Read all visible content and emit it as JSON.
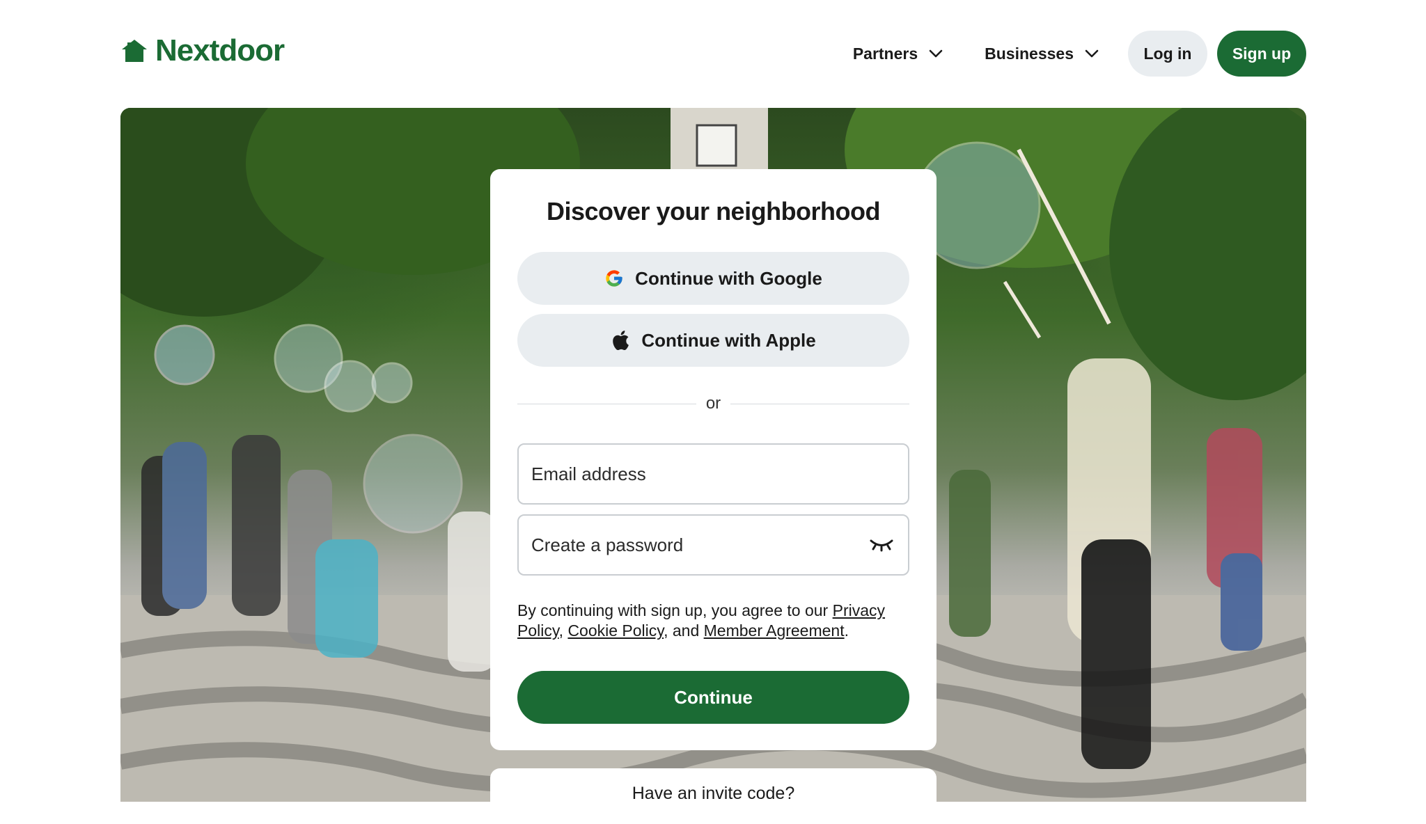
{
  "brand": {
    "name": "Nextdoor",
    "color": "#1b6b34",
    "logo_icon": "house-icon"
  },
  "nav": {
    "partners_label": "Partners",
    "businesses_label": "Businesses",
    "login_label": "Log in",
    "signup_label": "Sign up",
    "dropdown_icon": "chevron-down-icon"
  },
  "hero": {
    "image_description_icon": "photo-background"
  },
  "signup_card": {
    "title": "Discover your neighborhood",
    "google_label": "Continue with Google",
    "apple_label": "Continue with Apple",
    "divider_text": "or",
    "email_placeholder": "Email address",
    "password_placeholder": "Create a password",
    "password_toggle_icon": "eye-closed-icon",
    "terms": {
      "prefix": "By continuing with sign up, you agree to our ",
      "privacy_link": "Privacy Policy",
      "sep1": ", ",
      "cookie_link": "Cookie Policy",
      "sep2": ", and ",
      "member_link": "Member Agreement",
      "suffix": "."
    },
    "continue_label": "Continue"
  },
  "invite": {
    "label": "Have an invite code?"
  },
  "colors": {
    "primary_green": "#1b6b34",
    "button_gray": "#e9edf0",
    "text": "#1a1a1a"
  }
}
